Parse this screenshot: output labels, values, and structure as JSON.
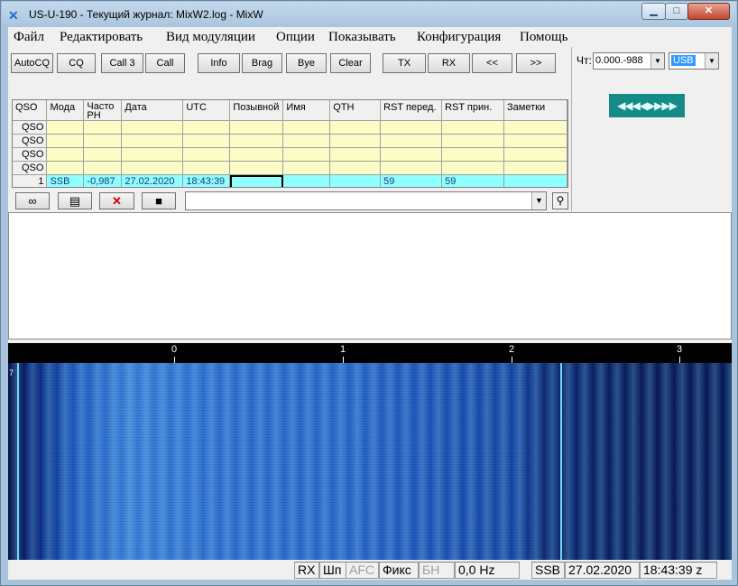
{
  "window": {
    "title": "US-U-190 - Текущий журнал: MixW2.log - MixW",
    "app_icon": "mixw-logo-icon",
    "controls": [
      "minimize-icon",
      "maximize-icon",
      "close-icon"
    ]
  },
  "menu": [
    "Файл",
    "Редактировать",
    "Вид модуляции",
    "Опции",
    "Показывать",
    "Конфигурация",
    "Помощь"
  ],
  "toolbar": [
    "AutoCQ",
    "CQ",
    "Call 3",
    "Call",
    "Info",
    "Brag",
    "Bye",
    "Clear",
    "TX",
    "RX",
    "<<",
    ">>"
  ],
  "right_panel": {
    "freq_label": "Чт:",
    "freq_value": "0.000.-988",
    "mode_value": "USB",
    "tuner_label": "◀◀◀◀▶▶▶▶"
  },
  "log": {
    "columns": [
      "QSO",
      "Мода",
      "Часто\nРН",
      "Дата",
      "UTC",
      "Позывной",
      "Имя",
      "QTH",
      "RST перед.",
      "RST прин.",
      "Заметки"
    ],
    "empty_rows": [
      "QSO",
      "QSO",
      "QSO",
      "QSO"
    ],
    "current_row": [
      "1",
      "SSB",
      "-0,987",
      "27.02.2020",
      "18:43:39",
      "",
      "",
      "",
      "59",
      "59",
      ""
    ]
  },
  "log_buttons": [
    "binoculars-icon",
    "notepad-icon",
    "delete-x-icon",
    "save-disk-icon"
  ],
  "callsign_search": {
    "value": ""
  },
  "waterfall": {
    "scale_labels": [
      "0",
      "1",
      "2",
      "3"
    ],
    "left_marker": "7"
  },
  "status": {
    "rx": "RX",
    "shp": "Шп",
    "afc": "AFC",
    "fix": "Фикс",
    "bn": "БН",
    "offset": "0,0 Hz",
    "mode": "SSB",
    "date": "27.02.2020",
    "time": "18:43:39 z"
  }
}
